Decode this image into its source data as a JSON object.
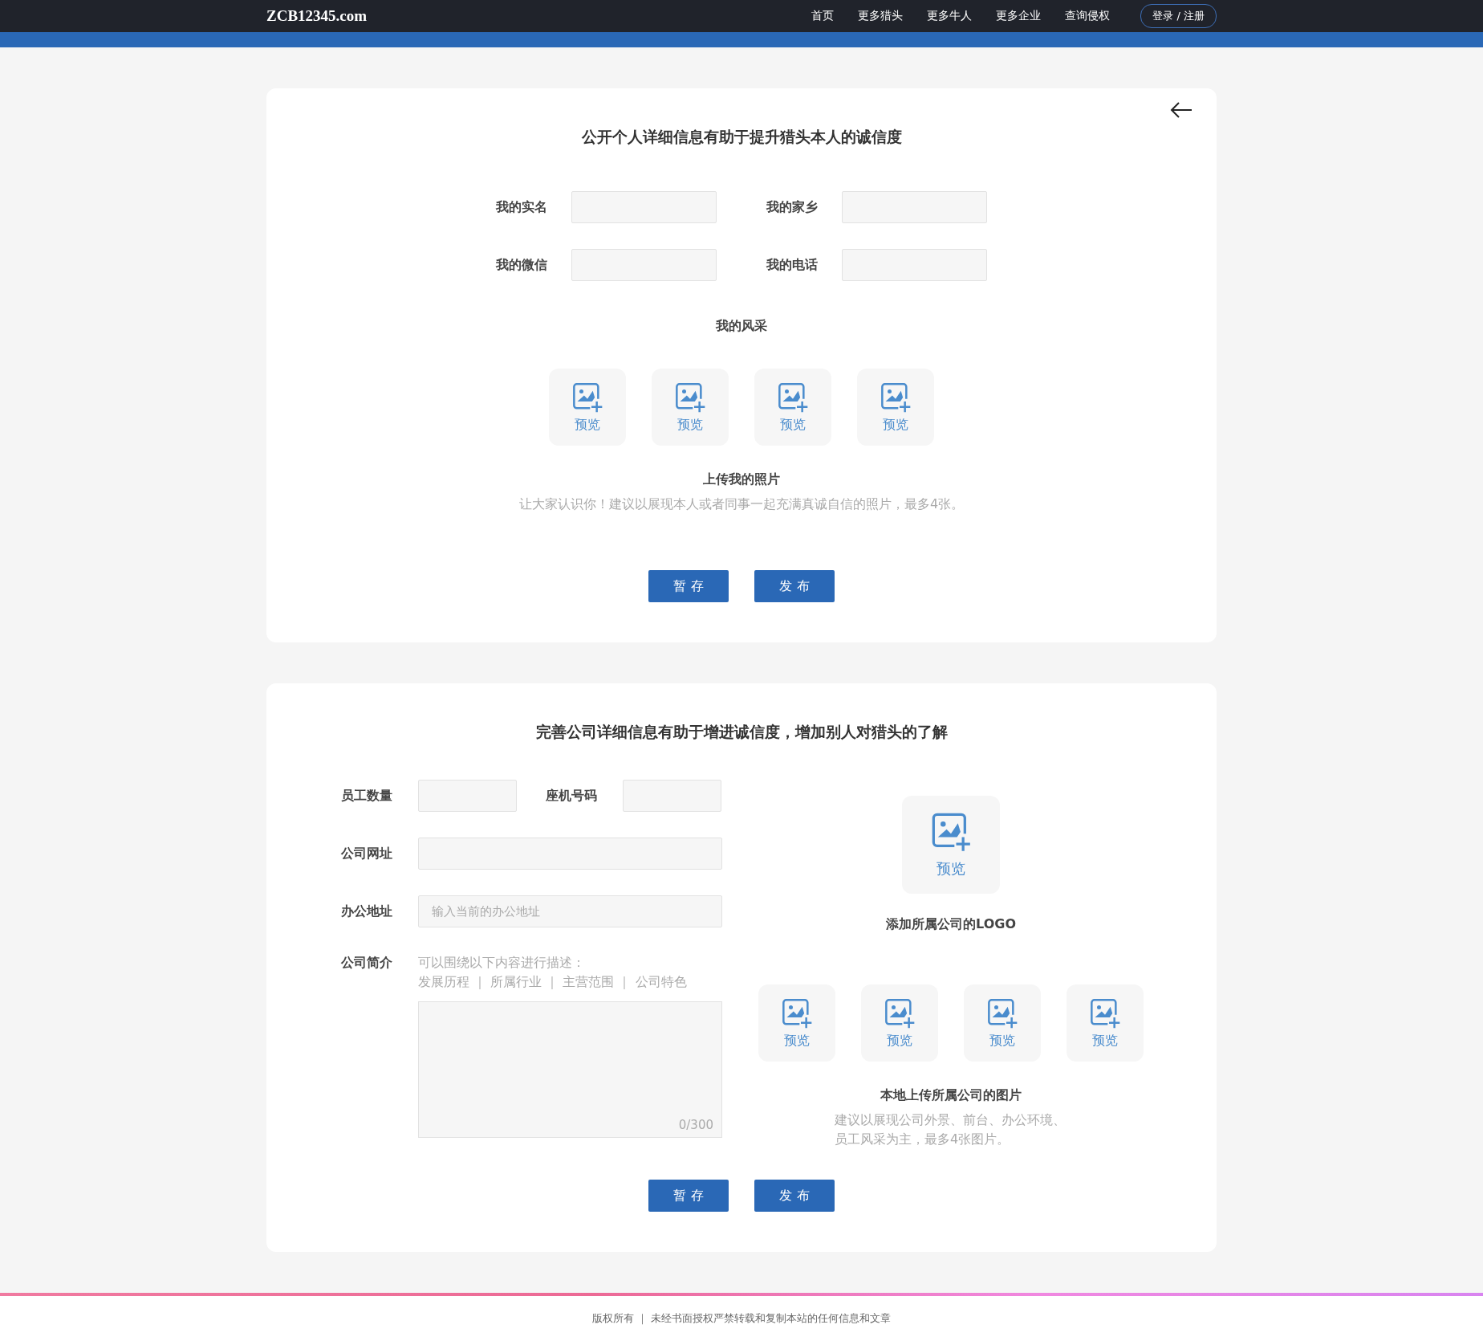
{
  "header": {
    "logo": "ZCB12345.com",
    "nav": [
      "首页",
      "更多猎头",
      "更多牛人",
      "更多企业",
      "查询侵权"
    ],
    "login": "登录 / 注册"
  },
  "personal": {
    "title": "公开个人详细信息有助于提升猎头本人的诚信度",
    "fields": [
      {
        "label": "我的实名"
      },
      {
        "label": "我的家乡"
      },
      {
        "label": "我的微信"
      },
      {
        "label": "我的电话"
      }
    ],
    "gallery_label": "我的风采",
    "tiles": [
      "预览",
      "预览",
      "预览",
      "预览"
    ],
    "upload_title": "上传我的照片",
    "upload_hint": "让大家认识你！建议以展现本人或者同事一起充满真诚自信的照片，最多4张。",
    "buttons": [
      "暂 存",
      "发 布"
    ]
  },
  "company": {
    "title": "完善公司详细信息有助于增进诚信度，增加别人对猎头的了解",
    "short_fields": [
      {
        "label": "员工数量"
      },
      {
        "label": "座机号码"
      }
    ],
    "wide_fields": [
      {
        "label": "公司网址"
      },
      {
        "label": "办公地址",
        "placeholder": "输入当前的办公地址"
      }
    ],
    "intro": {
      "label": "公司简介",
      "hint_lines": [
        "可以围绕以下内容进行描述：",
        "发展历程 ｜ 所属行业 ｜ 主营范围 ｜ 公司特色"
      ],
      "counter": "0/300"
    },
    "logo_tile": "预览",
    "logo_label": "添加所属公司的LOGO",
    "tiles": [
      "预览",
      "预览",
      "预览",
      "预览"
    ],
    "upload_title": "本地上传所属公司的图片",
    "upload_hint": "建议以展现公司外景、前台、办公环境、员工风采为主，最多4张图片。",
    "buttons": [
      "暂 存",
      "发 布"
    ]
  },
  "footer": "版权所有 ｜ 未经书面授权严禁转载和复制本站的任何信息和文章"
}
